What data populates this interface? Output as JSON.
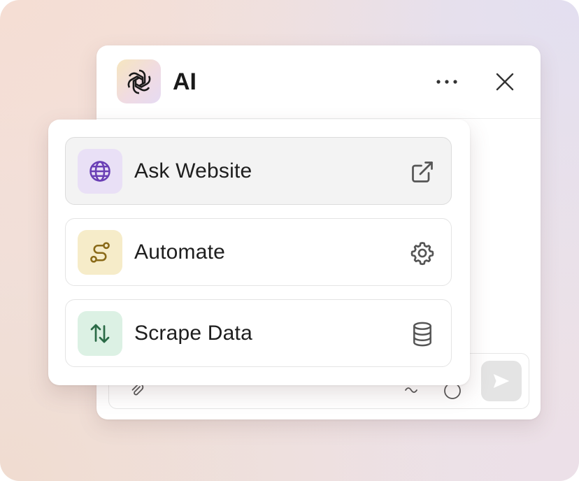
{
  "window": {
    "title": "AI",
    "icons": {
      "logo": "openai-logo-icon",
      "more": "more-horizontal-icon",
      "close": "close-icon"
    }
  },
  "composer": {
    "icons": {
      "attach": "paperclip-icon",
      "mic": "mic-icon",
      "emoji": "emoji-icon",
      "send": "send-icon"
    }
  },
  "menu": {
    "items": [
      {
        "label": "Ask Website",
        "icon": "globe-icon",
        "trailing_icon": "external-link-icon",
        "accent_bg": "#e9e0f6",
        "accent_fg": "#6a3fb5",
        "active": true
      },
      {
        "label": "Automate",
        "icon": "route-icon",
        "trailing_icon": "settings-gear-icon",
        "accent_bg": "#f6ecc9",
        "accent_fg": "#8a6a18",
        "active": false
      },
      {
        "label": "Scrape Data",
        "icon": "arrows-up-down-icon",
        "trailing_icon": "database-icon",
        "accent_bg": "#dcf1e4",
        "accent_fg": "#2b6b47",
        "active": false
      }
    ]
  },
  "colors": {
    "text": "#1e1e1e",
    "icon_gray": "#555555",
    "border": "#e4e4e4",
    "send_bg": "#e4e4e4"
  }
}
